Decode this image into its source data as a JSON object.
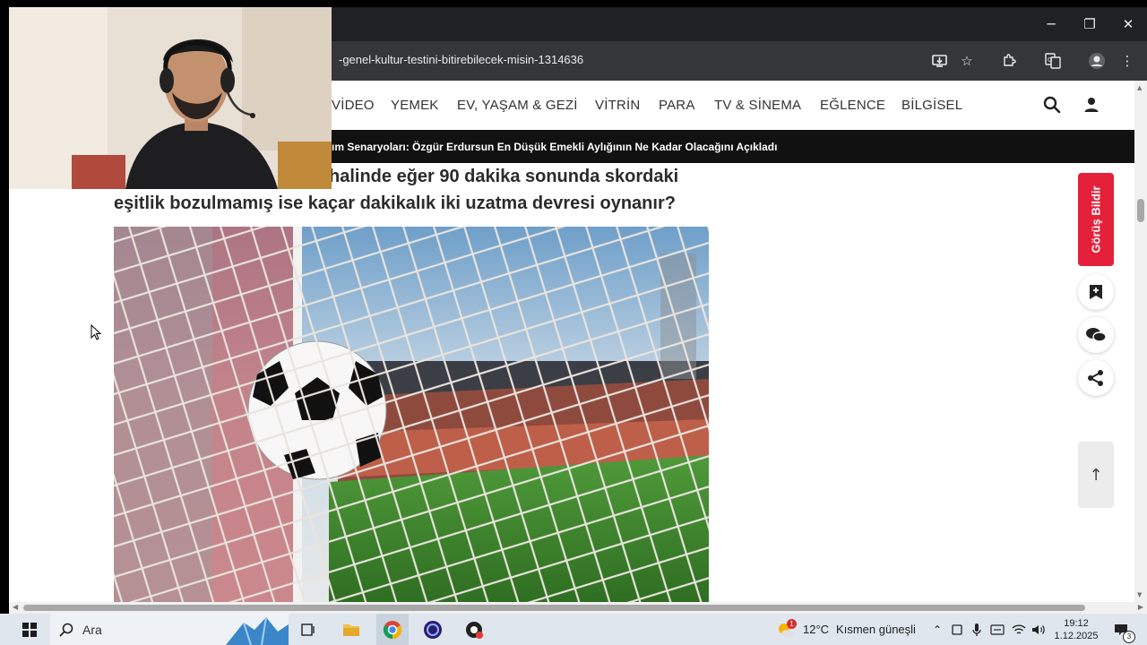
{
  "browser": {
    "url": "-genel-kultur-testini-bitirebilecek-misin-1314636",
    "window_controls": {
      "minimize": "─",
      "restore": "❐",
      "close": "✕"
    }
  },
  "nav": {
    "items": [
      "VİDEO",
      "YEMEK",
      "EV, YAŞAM & GEZİ",
      "VİTRİN",
      "PARA",
      "TV & SİNEMA",
      "EĞLENCE",
      "BİLGİSEL"
    ]
  },
  "ticker": {
    "text": "ım Senaryoları: Özgür Erdursun En Düşük Emekli Aylığının Ne Kadar Olacağını Açıkladı"
  },
  "article": {
    "question_line1": "halinde eğer 90 dakika sonunda skordaki",
    "question_line2": "eşitlik bozulmamış ise kaçar dakikalık iki uzatma devresi oynanır?"
  },
  "sidebar": {
    "feedback_label": "Görüş Bildir",
    "scroll_top": "↑"
  },
  "taskbar": {
    "search_label": "Ara",
    "weather_temp": "12°C",
    "weather_text": "Kısmen güneşli",
    "time": "19:12",
    "date": "1.12.2025",
    "notification_count": "3",
    "weather_badge": "1"
  },
  "colors": {
    "accent_red": "#e5203a",
    "ticker_bg": "#111111",
    "chrome_dark": "#202124",
    "taskbar_bg": "#dfe6ee"
  }
}
